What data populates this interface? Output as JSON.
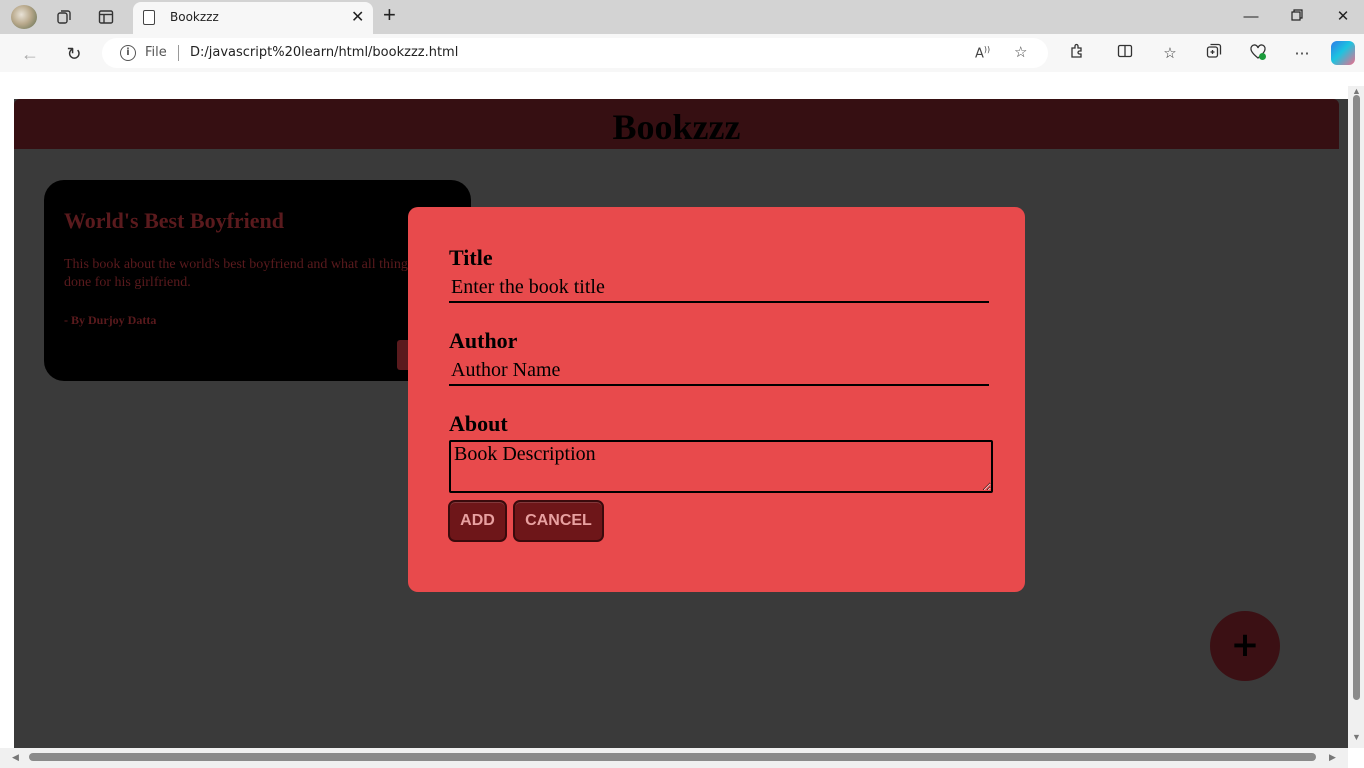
{
  "browser": {
    "tab_title": "Bookzzz",
    "address_scheme": "File",
    "url": "D:/javascript%20learn/html/bookzzz.html",
    "icons": [
      "profile-avatar",
      "collections-icon",
      "tab-actions-icon",
      "back-arrow-icon",
      "refresh-icon",
      "read-aloud-icon",
      "favorite-star-icon",
      "extensions-icon",
      "split-screen-icon",
      "favorites-icon",
      "collections-icon",
      "browser-essentials-icon",
      "more-icon",
      "copilot-icon"
    ]
  },
  "page": {
    "title": "Bookzzz",
    "header_color": "#360f12",
    "background_color": "#3a3a3a"
  },
  "book_card": {
    "title": "World's Best Boyfriend",
    "description": "This book about the world's best boyfriend and what all things he done for his girlfriend.",
    "author": "- By Durjoy Datta"
  },
  "modal": {
    "background_color": "#e84a4c",
    "title_label": "Title",
    "title_placeholder": "Enter the book title",
    "author_label": "Author",
    "author_placeholder": "Author Name",
    "about_label": "About",
    "about_placeholder": "Book Description",
    "add_button": "ADD",
    "cancel_button": "CANCEL"
  },
  "fab": {
    "label": "+",
    "icon": "plus-icon"
  }
}
